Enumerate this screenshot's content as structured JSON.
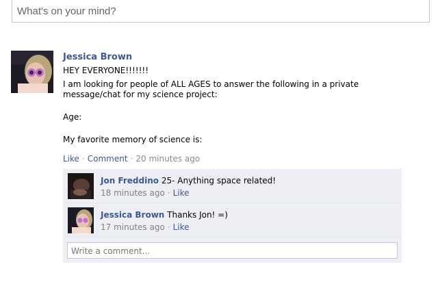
{
  "status": {
    "placeholder": "What's on your mind?"
  },
  "post": {
    "author": "Jessica Brown",
    "lines": [
      "HEY EVERYONE!!!!!!!",
      "I am looking for people of ALL AGES to answer the following in a private message/chat for my science project:",
      "Age:",
      "My favorite memory of science is:"
    ],
    "like_label": "Like",
    "comment_label": "Comment",
    "time": "20 minutes ago"
  },
  "comments": [
    {
      "author": "Jon Freddino",
      "text": "25- Anything space related!",
      "time": "18 minutes ago",
      "like_label": "Like"
    },
    {
      "author": "Jessica Brown",
      "text": "Thanks Jon! =)",
      "time": "17 minutes ago",
      "like_label": "Like"
    }
  ],
  "write_comment": {
    "placeholder": "Write a comment..."
  }
}
